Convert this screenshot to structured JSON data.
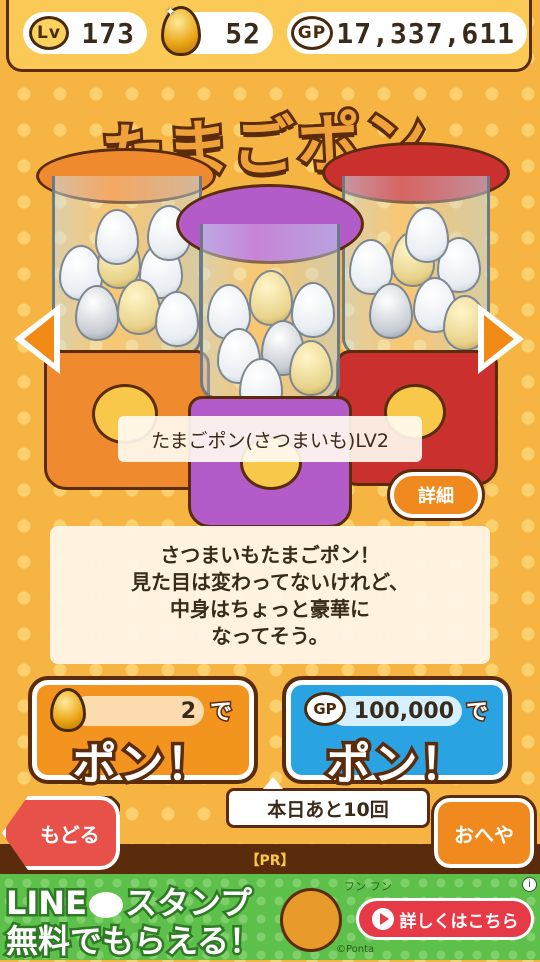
{
  "status": {
    "level_label": "Lv",
    "level": "173",
    "golden_eggs": "52",
    "gp_label": "GP",
    "gp": "17,337,611"
  },
  "title": "たまごポン",
  "machine_name": "たまごポン(さつまいも)LV2",
  "detail_label": "詳細",
  "description": [
    "さつまいもたまごポン！",
    "見た目は変わってないけれど、",
    "中身はちょっと豪華に",
    "なってそう。"
  ],
  "egg_button": {
    "cost": "2",
    "suffix": "で",
    "label": "ポン！"
  },
  "gp_button": {
    "icon_label": "GP",
    "cost": "100,000",
    "suffix": "で",
    "label": "ポン！"
  },
  "remaining_today": "本日あと10回",
  "back_label": "もどる",
  "room_label": "おへや",
  "pr_label": "【PR】",
  "banner": {
    "line1_a": "LINE",
    "line1_b": "スタンプ",
    "line2": "無料でもらえる！",
    "fun": "フン フン",
    "button": "詳しくはこちら",
    "credit": "©Ponta",
    "info": "i"
  },
  "colors": {
    "background": "#f6b443",
    "outline": "#5a2c0b",
    "orange_blender": "#f08a2e",
    "purple_blender": "#b35bc9",
    "red_blender": "#c9302e",
    "egg_button": "#f3941e",
    "gp_button": "#2aa3e2",
    "banner": "#5cc04a"
  },
  "icons": [
    "level-badge-icon",
    "golden-egg-icon",
    "gp-coin-icon",
    "left-arrow-icon",
    "right-arrow-icon"
  ]
}
